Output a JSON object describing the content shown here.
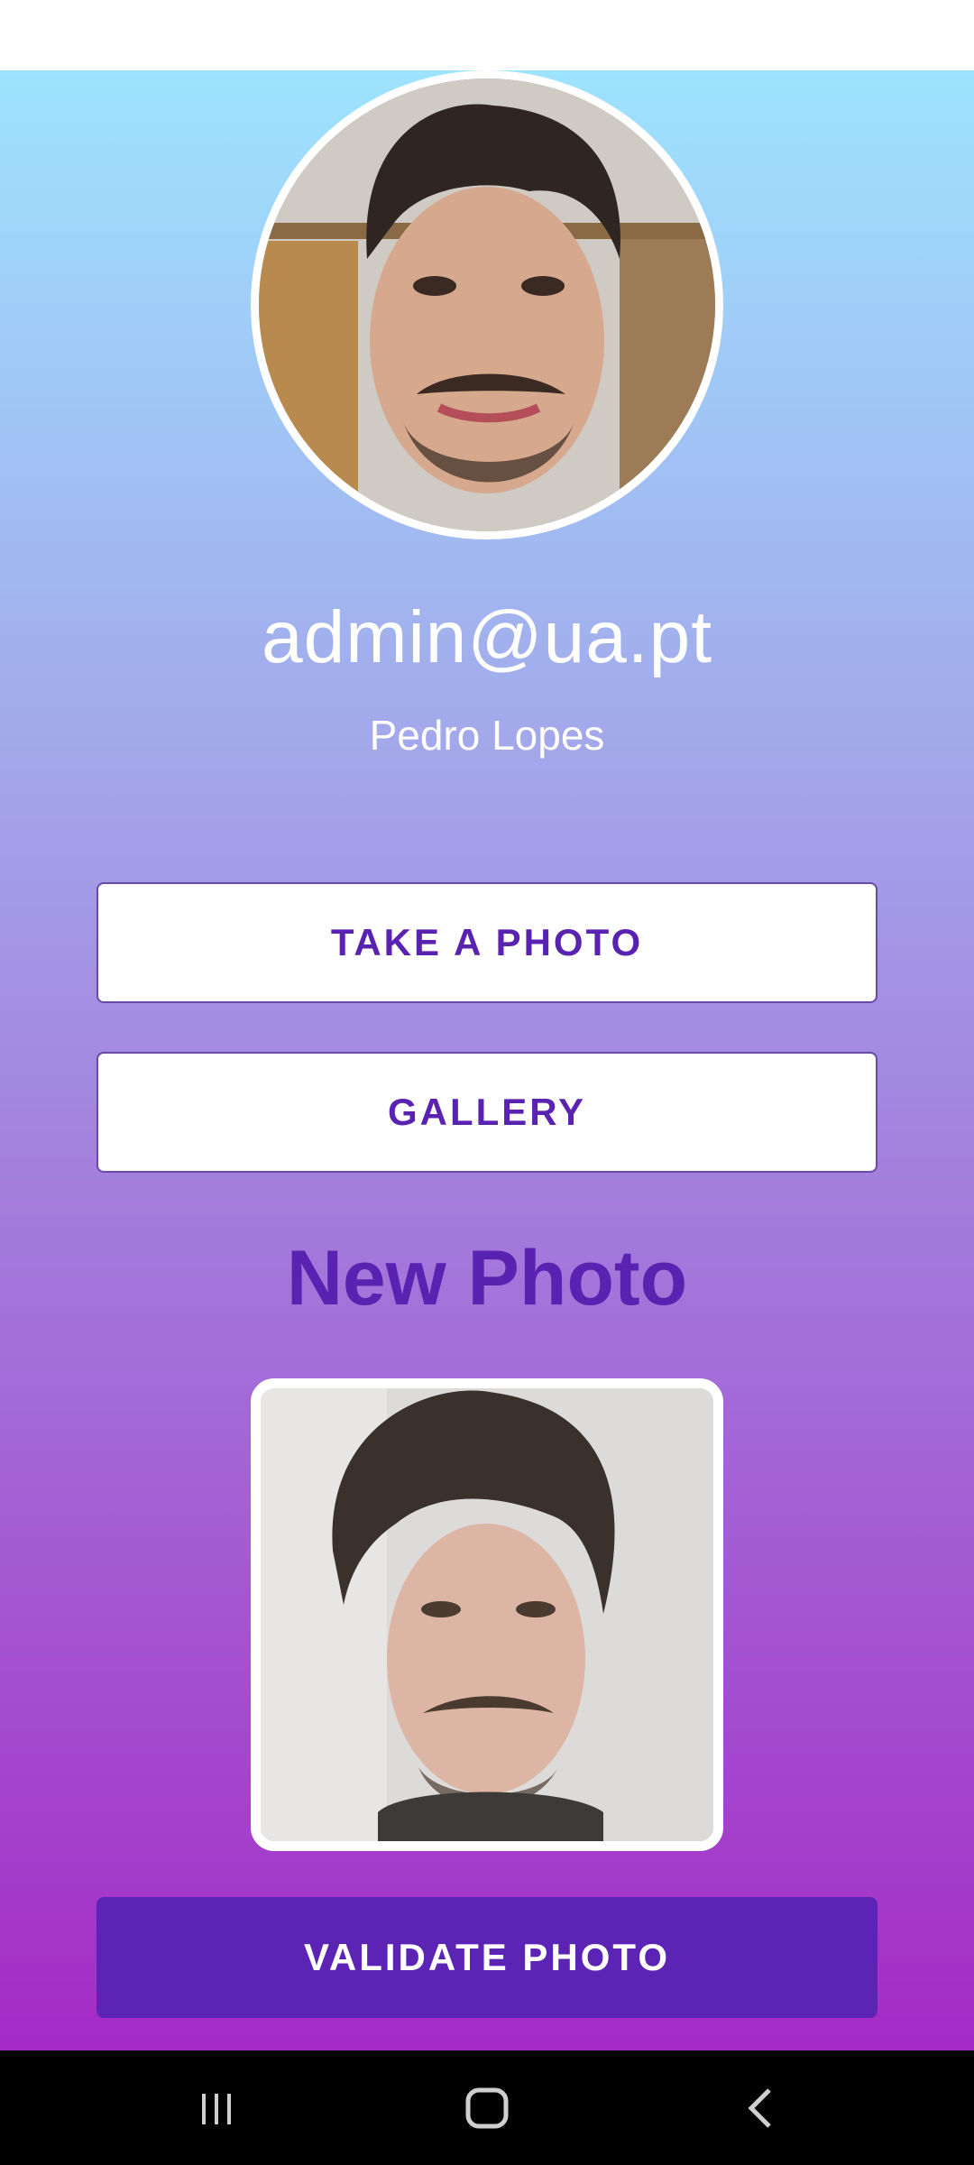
{
  "profile": {
    "email": "admin@ua.pt",
    "name": "Pedro Lopes"
  },
  "actions": {
    "take_photo": "TAKE A PHOTO",
    "gallery": "GALLERY",
    "validate": "VALIDATE PHOTO"
  },
  "new_photo": {
    "title": "New Photo"
  },
  "navigation": {
    "icons": [
      "recent-apps-icon",
      "home-icon",
      "back-icon"
    ]
  },
  "colors": {
    "accent": "#5b24b5",
    "gradient_top": "#9ee3ff",
    "gradient_bottom": "#a52ac6"
  }
}
